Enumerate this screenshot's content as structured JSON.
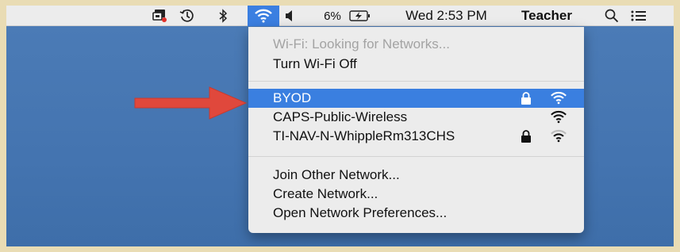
{
  "menubar": {
    "battery_percent": "6%",
    "datetime": "Wed 2:53 PM",
    "user": "Teacher"
  },
  "wifi_menu": {
    "status": "Wi-Fi: Looking for Networks...",
    "toggle": "Turn Wi-Fi Off",
    "networks": [
      {
        "name": "BYOD",
        "secured": true,
        "selected": true
      },
      {
        "name": "CAPS-Public-Wireless",
        "secured": false,
        "selected": false
      },
      {
        "name": "TI-NAV-N-WhippleRm313CHS",
        "secured": true,
        "selected": false
      }
    ],
    "join_other": "Join Other Network...",
    "create": "Create Network...",
    "preferences": "Open Network Preferences..."
  },
  "colors": {
    "desktop": "#4474b0",
    "selection": "#3a7fe0",
    "arrow": "#e0483c"
  },
  "icons": [
    "screen-sharing-icon",
    "time-machine-icon",
    "bluetooth-icon",
    "wifi-icon",
    "volume-icon",
    "battery-charging-icon",
    "spotlight-search-icon",
    "notification-center-icon",
    "lock-icon",
    "red-arrow"
  ]
}
